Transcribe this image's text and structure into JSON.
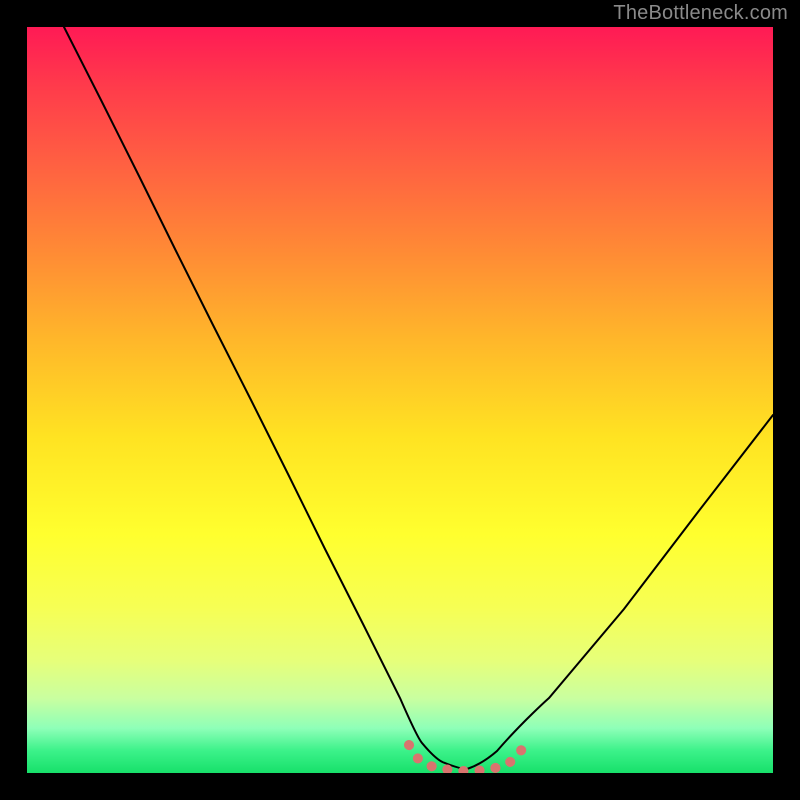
{
  "watermark": "TheBottleneck.com",
  "chart_data": {
    "type": "line",
    "title": "",
    "xlabel": "",
    "ylabel": "",
    "xlim": [
      0,
      100
    ],
    "ylim": [
      0,
      100
    ],
    "grid": false,
    "legend": false,
    "notes": "V-shaped bottleneck curve over a vertical red→green gradient. Y represents mismatch/bottleneck percentage (top = high/red = bad, bottom = low/green = good). Minimum near x≈58 where curve touches the green band; small coral dotted segment hugs the bottom around the minimum.",
    "series": [
      {
        "name": "bottleneck-curve",
        "x": [
          5,
          10,
          15,
          20,
          25,
          30,
          35,
          40,
          45,
          50,
          53,
          56,
          58,
          60,
          63,
          70,
          80,
          90,
          100
        ],
        "y": [
          100,
          90,
          80,
          70,
          60,
          50,
          40,
          30,
          20,
          10,
          5,
          2,
          0,
          1,
          3,
          10,
          22,
          35,
          48
        ]
      }
    ],
    "bottom_marker": {
      "description": "coral dotted U at the valley floor",
      "x_range": [
        51,
        65
      ],
      "y": 0
    },
    "background_gradient": {
      "top_color": "#ff1a55",
      "bottom_color": "#17e06a"
    }
  }
}
